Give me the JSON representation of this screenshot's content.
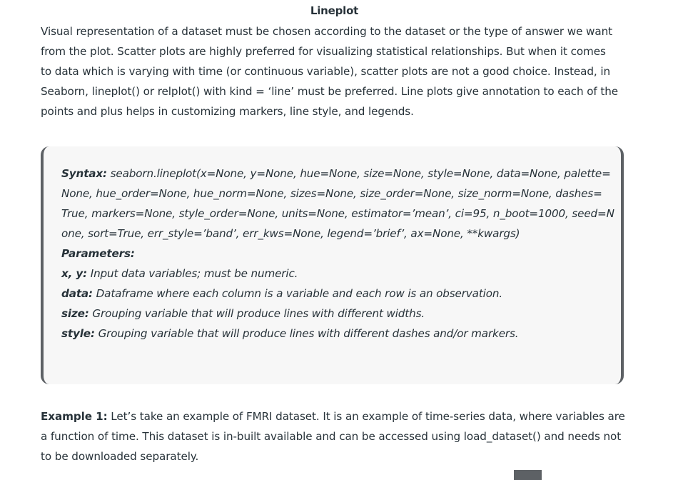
{
  "title": "Lineplot",
  "intro": [
    "Visual representation of a dataset must be chosen according to the dataset or the type of answer we want",
    "from the plot. Scatter plots are highly preferred for visualizing statistical relationships. But when it comes",
    "to data which is varying with time (or continuous variable), scatter plots are not a good choice. Instead, in",
    "Seaborn, lineplot() or relplot() with kind = ‘line’ must be preferred. Line plots give annotation to each of the",
    "points and plus helps in customizing markers, line style, and legends."
  ],
  "syntax": {
    "label": "Syntax:",
    "lines": [
      " seaborn.lineplot(x=None, y=None, hue=None, size=None, style=None, data=None, palette=",
      "None, hue_order=None, hue_norm=None, sizes=None, size_order=None, size_norm=None, dashes=",
      "True, markers=None, style_order=None, units=None, estimator=’mean’, ci=95, n_boot=1000, seed=N",
      "one, sort=True, err_style=’band’, err_kws=None, legend=’brief’, ax=None, **kwargs)"
    ],
    "parameters_heading": "Parameters:",
    "params": [
      {
        "name": "x, y:",
        "desc": " Input data variables; must be numeric."
      },
      {
        "name": "data:",
        "desc": " Dataframe where each column is a variable and each row is an observation."
      },
      {
        "name": "size:",
        "desc": " Grouping variable that will produce lines with different widths."
      },
      {
        "name": "style:",
        "desc": " Grouping variable that will produce lines with different dashes and/or markers."
      }
    ]
  },
  "example": {
    "label": "Example 1:",
    "lines": [
      " Let’s take an example of FMRI dataset. It is an example of time-series data, where variables are",
      "a function of time. This dataset is in-built available and can be accessed using load_dataset() and needs not",
      "to be downloaded separately."
    ]
  }
}
